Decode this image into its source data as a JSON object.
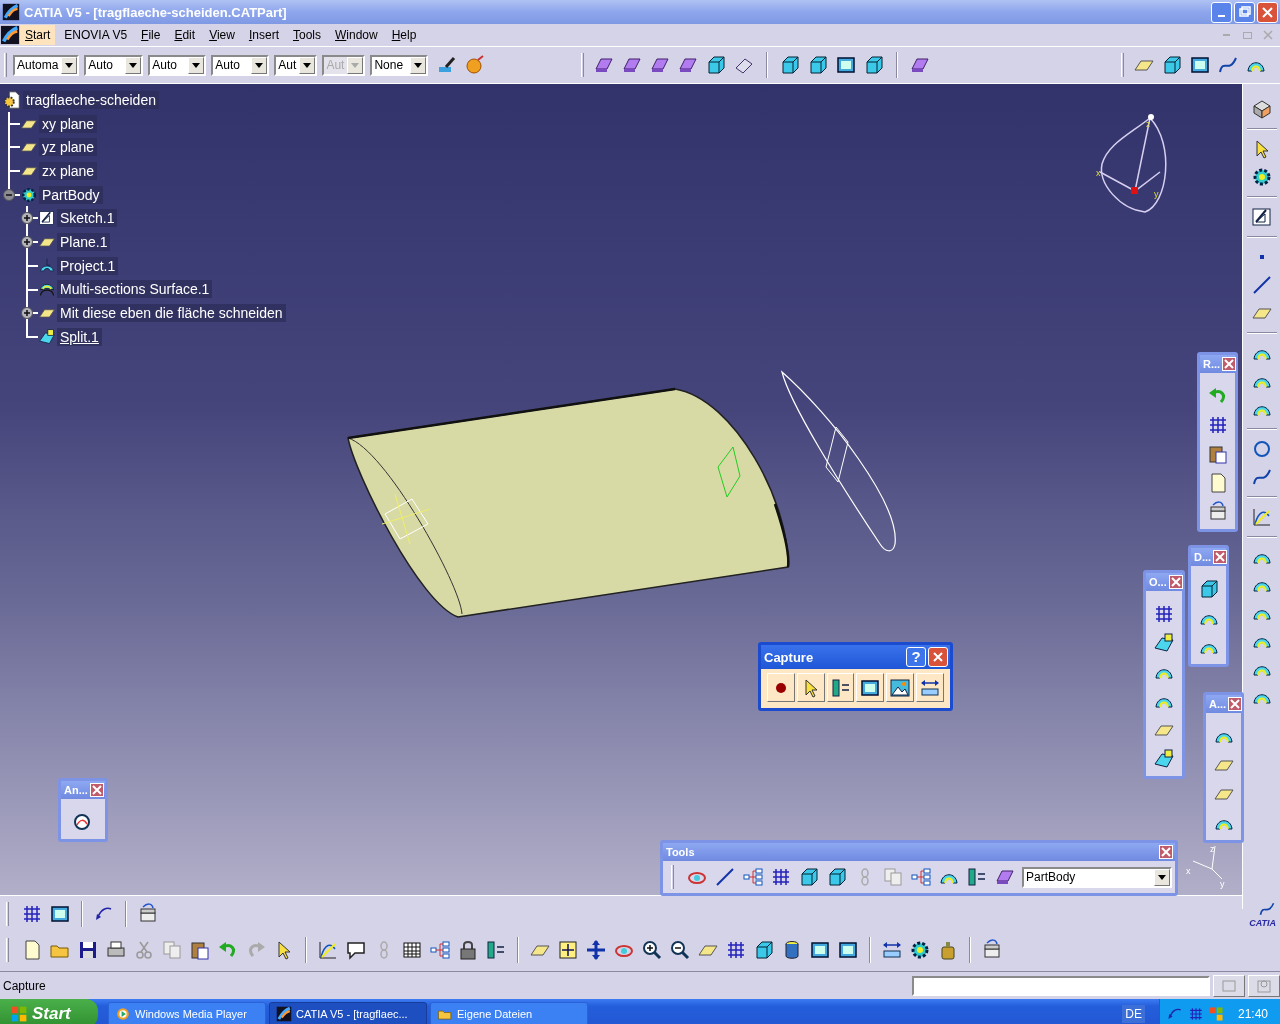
{
  "window": {
    "title": "CATIA V5 - [tragflaeche-scheiden.CATPart]"
  },
  "menu": [
    {
      "label": "Start",
      "mnemonic": true,
      "selected": true
    },
    {
      "label": "ENOVIA V5",
      "mnemonic": false,
      "selected": false
    },
    {
      "label": "File",
      "mnemonic": true,
      "selected": false
    },
    {
      "label": "Edit",
      "mnemonic": true,
      "selected": false
    },
    {
      "label": "View",
      "mnemonic": true,
      "selected": false
    },
    {
      "label": "Insert",
      "mnemonic": true,
      "selected": false
    },
    {
      "label": "Tools",
      "mnemonic": true,
      "selected": false
    },
    {
      "label": "Window",
      "mnemonic": true,
      "selected": false
    },
    {
      "label": "Help",
      "mnemonic": true,
      "selected": false
    }
  ],
  "graphic_properties": {
    "dropdowns": [
      {
        "value": "Automa",
        "disabled": false
      },
      {
        "value": "Auto",
        "disabled": false
      },
      {
        "value": "Auto",
        "disabled": false
      },
      {
        "value": "Auto",
        "disabled": false
      },
      {
        "value": "Aut",
        "disabled": false
      },
      {
        "value": "Aut",
        "disabled": true
      },
      {
        "value": "None",
        "disabled": false
      }
    ]
  },
  "tree": {
    "root": {
      "label": "tragflaeche-scheiden",
      "kind": "part"
    },
    "children": [
      {
        "label": "xy plane",
        "kind": "plane"
      },
      {
        "label": "yz plane",
        "kind": "plane"
      },
      {
        "label": "zx plane",
        "kind": "plane"
      },
      {
        "label": "PartBody",
        "kind": "body",
        "expanded": true,
        "children": [
          {
            "label": "Sketch.1",
            "kind": "sketch",
            "expanded": false,
            "current": false
          },
          {
            "label": "Plane.1",
            "kind": "plane",
            "expanded": false,
            "current": false
          },
          {
            "label": "Project.1",
            "kind": "projection",
            "current": false
          },
          {
            "label": "Multi-sections Surface.1",
            "kind": "loft",
            "current": false
          },
          {
            "label": "Mit diese eben die fläche schneiden",
            "kind": "plane",
            "expanded": false,
            "current": false
          },
          {
            "label": "Split.1",
            "kind": "split",
            "current": true
          }
        ]
      }
    ]
  },
  "compass": {
    "labels": [
      "z",
      "x",
      "y"
    ]
  },
  "capture_toolbar": {
    "title": "Capture",
    "help": "?"
  },
  "tools_toolbar": {
    "title": "Tools",
    "body": "PartBody"
  },
  "floating_toolbars": [
    {
      "title": "R..."
    },
    {
      "title": "D..."
    },
    {
      "title": "O..."
    },
    {
      "title": "A..."
    },
    {
      "title": "An..."
    }
  ],
  "axis": {
    "labels": [
      "z",
      "x",
      "y"
    ]
  },
  "logo": {
    "name": "CATIA"
  },
  "status_bar": {
    "text": "Capture"
  },
  "taskbar": {
    "start": "Start",
    "tasks": [
      {
        "label": "Windows Media Player",
        "selected": false
      },
      {
        "label": "CATIA V5 - [tragflaec...",
        "selected": true
      },
      {
        "label": "Eigene Dateien",
        "selected": false
      }
    ],
    "language": "DE",
    "clock": "21:40"
  }
}
